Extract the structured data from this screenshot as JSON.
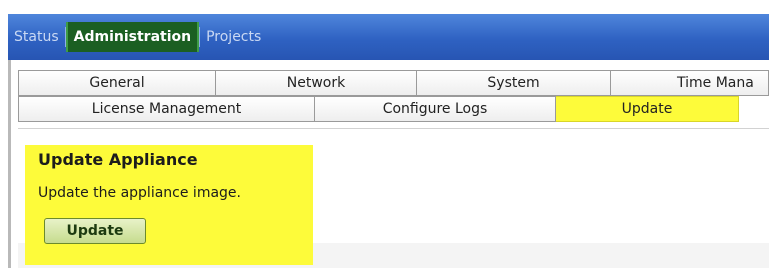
{
  "nav": {
    "items": [
      {
        "label": "Status",
        "active": false
      },
      {
        "label": "Administration",
        "active": true
      },
      {
        "label": "Projects",
        "active": false
      }
    ]
  },
  "tabs": {
    "row1": [
      "General",
      "Network",
      "System",
      "Time Mana"
    ],
    "row2": [
      "License Management",
      "Configure Logs",
      "Update"
    ],
    "selected": "Update"
  },
  "content": {
    "title": "Update Appliance",
    "description": "Update the appliance image.",
    "button_label": "Update"
  },
  "colors": {
    "nav_blue": "#2f62c2",
    "active_green": "#1b5f22",
    "highlight_yellow": "#fdfb3a",
    "button_green": "#c6dc8e"
  }
}
